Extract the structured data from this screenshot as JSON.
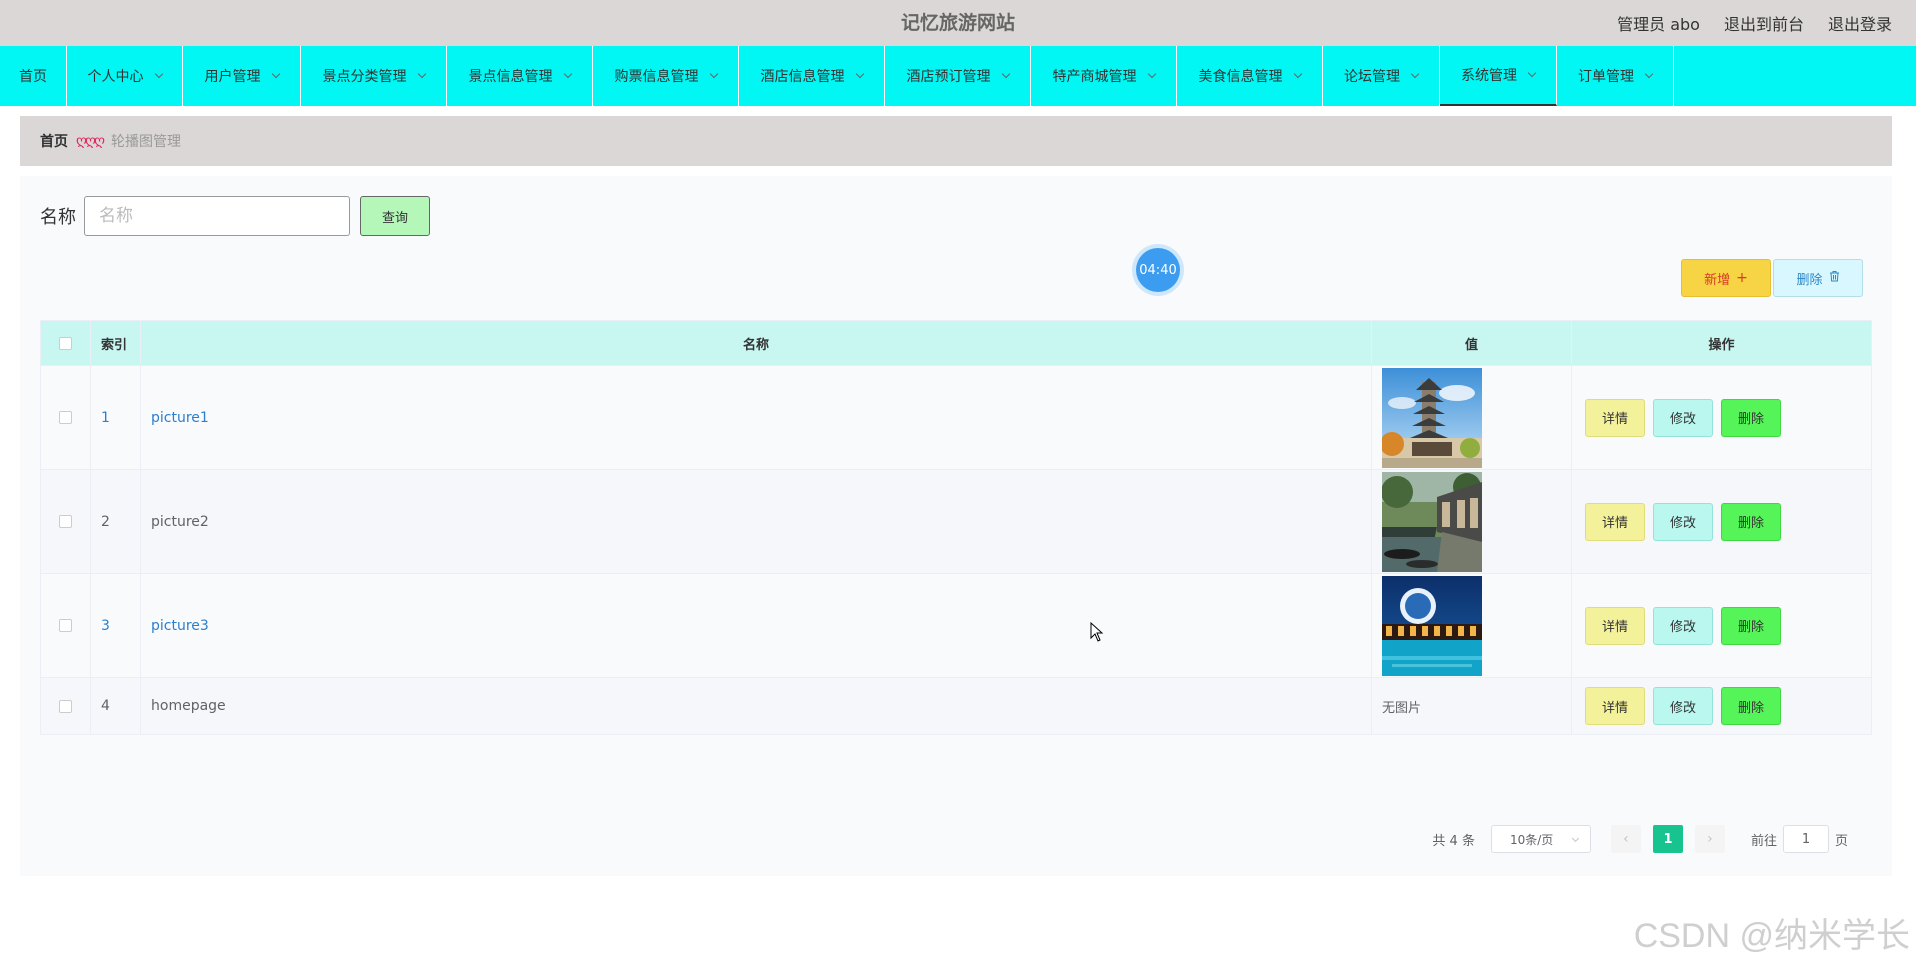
{
  "header": {
    "title": "记忆旅游网站",
    "admin": "管理员 abo",
    "to_front": "退出到前台",
    "logout": "退出登录"
  },
  "nav": {
    "items": [
      {
        "label": "首页",
        "width": 67,
        "dropdown": false
      },
      {
        "label": "个人中心",
        "width": 116,
        "dropdown": true
      },
      {
        "label": "用户管理",
        "width": 118,
        "dropdown": true
      },
      {
        "label": "景点分类管理",
        "width": 146,
        "dropdown": true
      },
      {
        "label": "景点信息管理",
        "width": 146,
        "dropdown": true
      },
      {
        "label": "购票信息管理",
        "width": 146,
        "dropdown": true
      },
      {
        "label": "酒店信息管理",
        "width": 146,
        "dropdown": true
      },
      {
        "label": "酒店预订管理",
        "width": 146,
        "dropdown": true
      },
      {
        "label": "特产商城管理",
        "width": 146,
        "dropdown": true
      },
      {
        "label": "美食信息管理",
        "width": 146,
        "dropdown": true
      },
      {
        "label": "论坛管理",
        "width": 117,
        "dropdown": true
      },
      {
        "label": "系统管理",
        "width": 117,
        "dropdown": true,
        "active": true
      },
      {
        "label": "订单管理",
        "width": 117,
        "dropdown": true
      }
    ]
  },
  "breadcrumb": {
    "home": "首页",
    "separator": "ღღღ",
    "current": "轮播图管理"
  },
  "search": {
    "label": "名称",
    "placeholder": "名称",
    "button": "查询"
  },
  "timer": "04:40",
  "actions": {
    "add": "新增",
    "add_icon": "+",
    "delete": "删除",
    "delete_icon": "🗑"
  },
  "table": {
    "headers": {
      "index": "索引",
      "name": "名称",
      "value": "值",
      "ops": "操作"
    },
    "ops": {
      "detail": "详情",
      "edit": "修改",
      "delete": "删除"
    },
    "rows": [
      {
        "index": "1",
        "name": "picture1",
        "image": "pagoda",
        "link": true
      },
      {
        "index": "2",
        "name": "picture2",
        "image": "canal",
        "link": false
      },
      {
        "index": "3",
        "name": "picture3",
        "image": "night-pool",
        "link": true
      },
      {
        "index": "4",
        "name": "homepage",
        "image": null,
        "value_text": "无图片",
        "link": false
      }
    ]
  },
  "pagination": {
    "total": "共 4 条",
    "page_size": "10条/页",
    "current": "1",
    "goto_prefix": "前往",
    "goto_value": "1",
    "goto_suffix": "页"
  },
  "watermark": "CSDN @纳米学长",
  "colors": {
    "nav_bg": "#00f7f3",
    "header_bg": "#dcd7d7",
    "table_head_bg": "#c8f6f1",
    "pager_active": "#17c38e"
  }
}
